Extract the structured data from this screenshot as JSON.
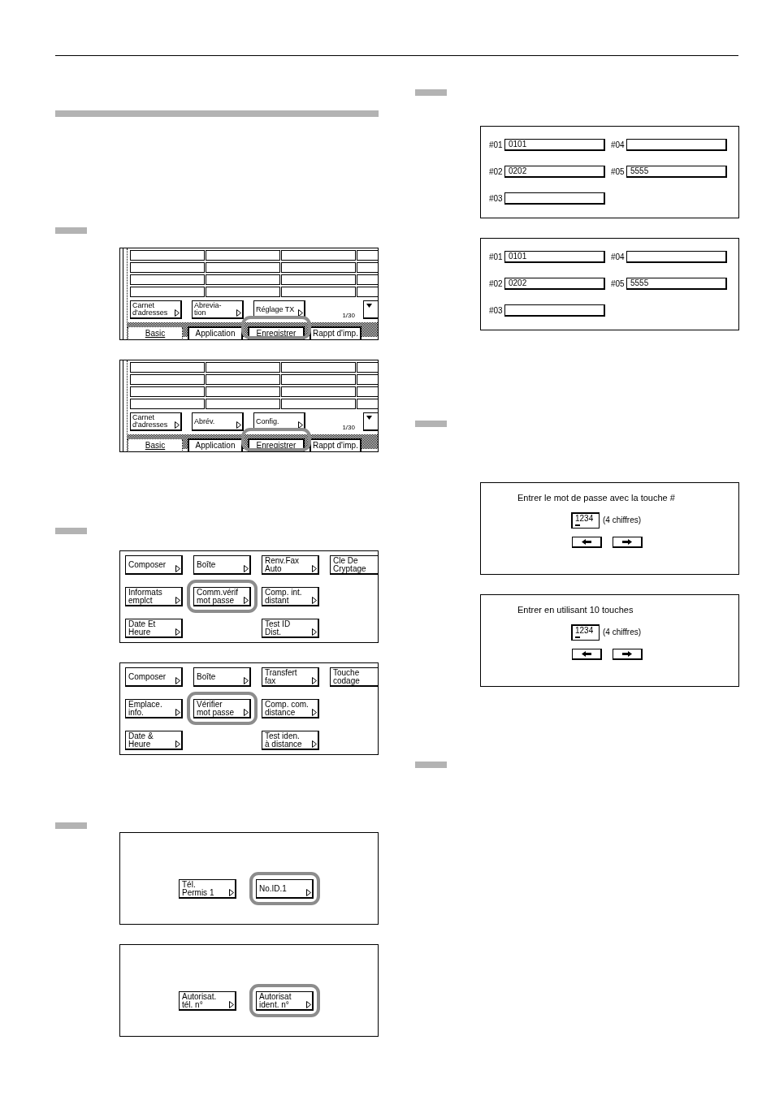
{
  "left_column": {
    "steps": [
      {
        "step_marker": true,
        "screens": [
          {
            "kind": "tab_screen",
            "buttons": [
              {
                "label": "Carnet\nd'adresses"
              },
              {
                "label": "Abrevia-\ntion"
              },
              {
                "label": "Réglage TX"
              }
            ],
            "page": "1/30",
            "tabs": [
              {
                "label": "Basic",
                "selected": true,
                "highlighted": false
              },
              {
                "label": "Application",
                "selected": false,
                "highlighted": false
              },
              {
                "label": "Enregistrer",
                "selected": false,
                "highlighted": true
              },
              {
                "label": "Rappt d'imp.",
                "selected": false,
                "highlighted": false
              }
            ]
          },
          {
            "kind": "tab_screen",
            "buttons": [
              {
                "label": "Carnet\nd'adresses"
              },
              {
                "label": "Abrév."
              },
              {
                "label": "Config."
              }
            ],
            "page": "1/30",
            "tabs": [
              {
                "label": "Basic",
                "selected": true,
                "highlighted": false
              },
              {
                "label": "Application",
                "selected": false,
                "highlighted": false
              },
              {
                "label": "Enregistrer",
                "selected": false,
                "highlighted": true
              },
              {
                "label": "Rappt d'imp.",
                "selected": false,
                "highlighted": false
              }
            ]
          }
        ]
      },
      {
        "step_marker": true,
        "screens": [
          {
            "kind": "menu_screen",
            "columns": [
              {
                "buttons": [
                  {
                    "label": "Composer",
                    "highlighted": false
                  },
                  {
                    "label": "Informats\nemplct",
                    "highlighted": false
                  },
                  {
                    "label": "Date Et\nHeure",
                    "highlighted": false
                  }
                ]
              },
              {
                "buttons": [
                  {
                    "label": "Boîte",
                    "highlighted": false
                  },
                  {
                    "label": "Comm.vérif\nmot passe",
                    "highlighted": true
                  }
                ]
              },
              {
                "buttons": [
                  {
                    "label": "Renv.Fax\nAuto",
                    "highlighted": false
                  },
                  {
                    "label": "Comp. int.\ndistant",
                    "highlighted": false
                  },
                  {
                    "label": "Test ID\nDist.",
                    "highlighted": false
                  }
                ]
              },
              {
                "buttons": [
                  {
                    "label": "Cle De\nCryptage",
                    "highlighted": false
                  }
                ]
              }
            ]
          },
          {
            "kind": "menu_screen",
            "columns": [
              {
                "buttons": [
                  {
                    "label": "Composer",
                    "highlighted": false
                  },
                  {
                    "label": "Emplace.\ninfo.",
                    "highlighted": false
                  },
                  {
                    "label": "Date &\nHeure",
                    "highlighted": false
                  }
                ]
              },
              {
                "buttons": [
                  {
                    "label": "Boîte",
                    "highlighted": false
                  },
                  {
                    "label": "Vérifier\nmot passe",
                    "highlighted": true
                  }
                ]
              },
              {
                "buttons": [
                  {
                    "label": "Transfert\nfax",
                    "highlighted": false
                  },
                  {
                    "label": "Comp. com.\ndistance",
                    "highlighted": false
                  },
                  {
                    "label": "Test iden.\nà distance",
                    "highlighted": false
                  }
                ]
              },
              {
                "buttons": [
                  {
                    "label": "Touche\ncodage",
                    "highlighted": false
                  }
                ]
              }
            ]
          }
        ]
      },
      {
        "step_marker": true,
        "screens": [
          {
            "kind": "choice_screen",
            "buttons": [
              {
                "label": "Tél.\nPermis 1",
                "highlighted": false
              },
              {
                "label": "No.ID.1",
                "highlighted": true
              }
            ]
          },
          {
            "kind": "choice_screen",
            "buttons": [
              {
                "label": "Autorisat.\ntél. n°",
                "highlighted": false
              },
              {
                "label": "Autorisat\nident. n°",
                "highlighted": true
              }
            ]
          }
        ]
      }
    ]
  },
  "right_column": {
    "steps": [
      {
        "step_marker": true,
        "screens": [
          {
            "kind": "fields_screen",
            "columns": [
              {
                "fields": [
                  {
                    "label": "#01",
                    "value": "0101"
                  },
                  {
                    "label": "#02",
                    "value": "0202"
                  },
                  {
                    "label": "#03"
                  }
                ]
              },
              {
                "fields": [
                  {
                    "label": "#04"
                  },
                  {
                    "label": "#05",
                    "value": "5555"
                  }
                ]
              }
            ]
          },
          {
            "kind": "fields_screen",
            "columns": [
              {
                "fields": [
                  {
                    "label": "#01",
                    "value": "0101"
                  },
                  {
                    "label": "#02",
                    "value": "0202"
                  },
                  {
                    "label": "#03"
                  }
                ]
              },
              {
                "fields": [
                  {
                    "label": "#04"
                  },
                  {
                    "label": "#05",
                    "value": "5555"
                  }
                ]
              }
            ]
          }
        ]
      },
      {
        "step_marker": true,
        "screens": [
          {
            "kind": "password_screen",
            "prompt": "Entrer le mot de passe avec la touche #",
            "value": "1234",
            "note": "(4 chiffres)"
          },
          {
            "kind": "password_screen",
            "prompt": "Entrer en utilisant 10 touches",
            "value": "1234",
            "note": "(4 chiffres)"
          }
        ]
      },
      {
        "step_marker": true
      }
    ]
  }
}
